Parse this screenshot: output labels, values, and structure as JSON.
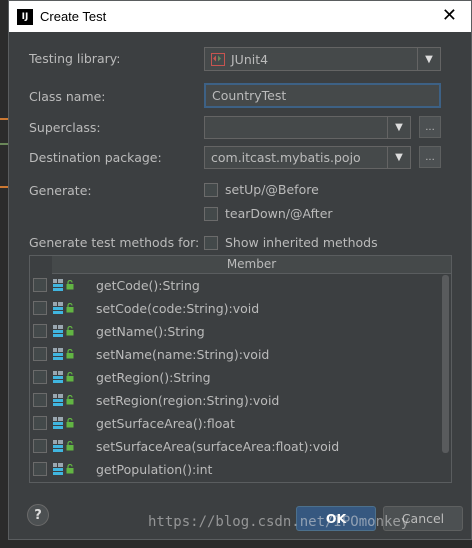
{
  "window": {
    "title": "Create Test",
    "app_icon_label": "IJ",
    "close_glyph": "✕"
  },
  "form": {
    "testing_library": {
      "label": "Testing library:",
      "value": "JUnit4"
    },
    "class_name": {
      "label": "Class name:",
      "value": "CountryTest"
    },
    "superclass": {
      "label": "Superclass:",
      "value": ""
    },
    "destination_package": {
      "label": "Destination package:",
      "value": "com.itcast.mybatis.pojo"
    },
    "generate": {
      "label": "Generate:",
      "options": [
        "setUp/@Before",
        "tearDown/@After"
      ]
    },
    "test_methods": {
      "label": "Generate test methods for:",
      "show_inherited_label": "Show inherited methods"
    },
    "browse_label": "..."
  },
  "table": {
    "column_header": "Member",
    "rows": [
      "getCode():String",
      "setCode(code:String):void",
      "getName():String",
      "setName(name:String):void",
      "getRegion():String",
      "setRegion(region:String):void",
      "getSurfaceArea():float",
      "setSurfaceArea(surfaceArea:float):void",
      "getPopulation():int"
    ]
  },
  "buttons": {
    "help": "?",
    "ok": "OK",
    "cancel": "Cancel"
  },
  "watermark": "https://blog.csdn.net/IPOmonkey",
  "colors": {
    "accent": "#365880",
    "dialog_bg": "#3c3f41",
    "focus_border": "#3d6185"
  }
}
